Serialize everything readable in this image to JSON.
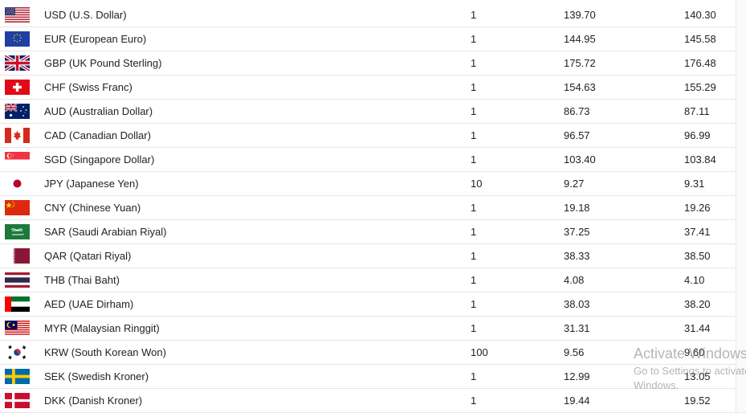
{
  "rows": [
    {
      "flag": "us-flag-icon",
      "name": "USD (U.S. Dollar)",
      "unit": "1",
      "buy": "139.70",
      "sell": "140.30"
    },
    {
      "flag": "eu-flag-icon",
      "name": "EUR (European Euro)",
      "unit": "1",
      "buy": "144.95",
      "sell": "145.58"
    },
    {
      "flag": "gb-flag-icon",
      "name": "GBP (UK Pound Sterling)",
      "unit": "1",
      "buy": "175.72",
      "sell": "176.48"
    },
    {
      "flag": "ch-flag-icon",
      "name": "CHF (Swiss Franc)",
      "unit": "1",
      "buy": "154.63",
      "sell": "155.29"
    },
    {
      "flag": "au-flag-icon",
      "name": "AUD (Australian Dollar)",
      "unit": "1",
      "buy": "86.73",
      "sell": "87.11"
    },
    {
      "flag": "ca-flag-icon",
      "name": "CAD (Canadian Dollar)",
      "unit": "1",
      "buy": "96.57",
      "sell": "96.99"
    },
    {
      "flag": "sg-flag-icon",
      "name": "SGD (Singapore Dollar)",
      "unit": "1",
      "buy": "103.40",
      "sell": "103.84"
    },
    {
      "flag": "jp-flag-icon",
      "name": "JPY (Japanese Yen)",
      "unit": "10",
      "buy": "9.27",
      "sell": "9.31"
    },
    {
      "flag": "cn-flag-icon",
      "name": "CNY (Chinese Yuan)",
      "unit": "1",
      "buy": "19.18",
      "sell": "19.26"
    },
    {
      "flag": "sa-flag-icon",
      "name": "SAR (Saudi Arabian Riyal)",
      "unit": "1",
      "buy": "37.25",
      "sell": "37.41"
    },
    {
      "flag": "qa-flag-icon",
      "name": "QAR (Qatari Riyal)",
      "unit": "1",
      "buy": "38.33",
      "sell": "38.50"
    },
    {
      "flag": "th-flag-icon",
      "name": "THB (Thai Baht)",
      "unit": "1",
      "buy": "4.08",
      "sell": "4.10"
    },
    {
      "flag": "ae-flag-icon",
      "name": "AED (UAE Dirham)",
      "unit": "1",
      "buy": "38.03",
      "sell": "38.20"
    },
    {
      "flag": "my-flag-icon",
      "name": "MYR (Malaysian Ringgit)",
      "unit": "1",
      "buy": "31.31",
      "sell": "31.44"
    },
    {
      "flag": "kr-flag-icon",
      "name": "KRW (South Korean Won)",
      "unit": "100",
      "buy": "9.56",
      "sell": "9.60"
    },
    {
      "flag": "se-flag-icon",
      "name": "SEK (Swedish Kroner)",
      "unit": "1",
      "buy": "12.99",
      "sell": "13.05"
    },
    {
      "flag": "dk-flag-icon",
      "name": "DKK (Danish Kroner)",
      "unit": "1",
      "buy": "19.44",
      "sell": "19.52"
    }
  ],
  "watermark": {
    "line1": "Activate Windows",
    "line2": "Go to Settings to activate Windows."
  }
}
